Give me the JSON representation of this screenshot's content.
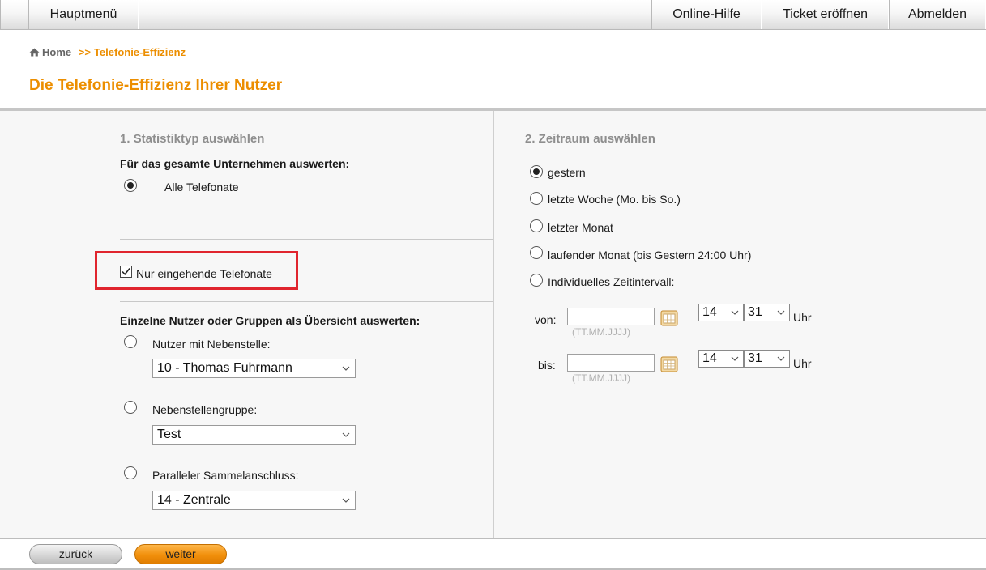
{
  "nav": {
    "main_menu": "Hauptmenü",
    "help": "Online-Hilfe",
    "ticket": "Ticket eröffnen",
    "logout": "Abmelden"
  },
  "breadcrumb": {
    "home": "Home",
    "separator": ">>",
    "current": "Telefonie-Effizienz"
  },
  "page_title": "Die Telefonie-Effizienz Ihrer Nutzer",
  "statistics": {
    "section_title": "1. Statistiktyp auswählen",
    "company_label": "Für das gesamte Unternehmen auswerten:",
    "all_calls": "Alle Telefonate",
    "all_calls_selected": true,
    "incoming_only": "Nur eingehende Telefonate",
    "incoming_only_checked": true,
    "overview_label": "Einzelne Nutzer oder Gruppen als Übersicht auswerten:",
    "user_ext_label": "Nutzer mit Nebenstelle:",
    "user_ext_value": "10 - Thomas Fuhrmann",
    "ext_group_label": "Nebenstellengruppe:",
    "ext_group_value": "Test",
    "hunt_group_label": "Paralleler Sammelanschluss:",
    "hunt_group_value": "14 - Zentrale"
  },
  "period": {
    "section_title": "2. Zeitraum auswählen",
    "options": [
      {
        "label": "gestern",
        "checked": true
      },
      {
        "label": "letzte Woche (Mo. bis So.)",
        "checked": false
      },
      {
        "label": "letzter Monat",
        "checked": false
      },
      {
        "label": "laufender Monat (bis Gestern 24:00 Uhr)",
        "checked": false
      },
      {
        "label": "Individuelles Zeitintervall:",
        "checked": false
      }
    ],
    "from_label": "von:",
    "to_label": "bis:",
    "date_hint": "(TT.MM.JJJJ)",
    "from_date": "",
    "to_date": "",
    "from_hour": "14",
    "from_minute": "31",
    "to_hour": "14",
    "to_minute": "31",
    "unit": "Uhr"
  },
  "footer": {
    "back": "zurück",
    "next": "weiter"
  },
  "colors": {
    "accent": "#ec8e00",
    "highlight": "#e0252e"
  }
}
